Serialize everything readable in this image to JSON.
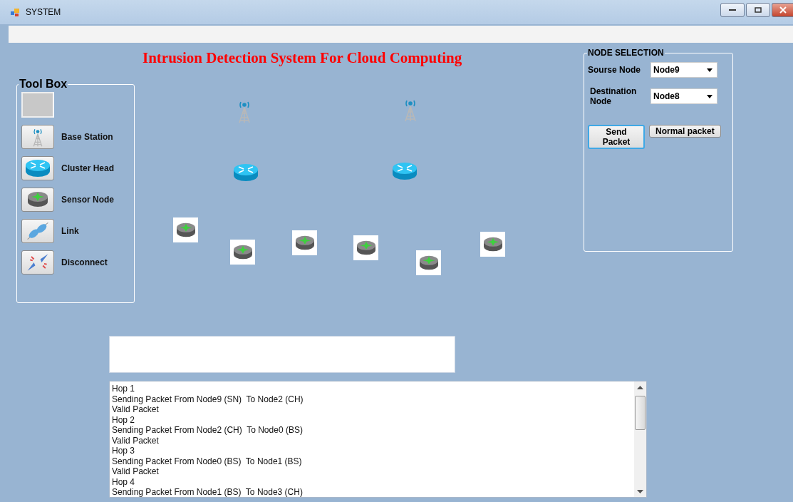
{
  "window": {
    "title": "SYSTEM"
  },
  "header": {
    "title": "Intrusion Detection System For Cloud Computing"
  },
  "tool_box": {
    "title": "Tool Box",
    "items": [
      {
        "kind": "blank"
      },
      {
        "kind": "base_station",
        "label": "Base Station"
      },
      {
        "kind": "cluster_head",
        "label": "Cluster Head"
      },
      {
        "kind": "sensor_node",
        "label": "Sensor Node"
      },
      {
        "kind": "link",
        "label": "Link"
      },
      {
        "kind": "disconnect",
        "label": "Disconnect"
      }
    ]
  },
  "network_nodes": [
    {
      "kind": "base_station"
    },
    {
      "kind": "base_station"
    },
    {
      "kind": "cluster_head"
    },
    {
      "kind": "cluster_head"
    },
    {
      "kind": "sensor_node"
    },
    {
      "kind": "sensor_node"
    },
    {
      "kind": "sensor_node"
    },
    {
      "kind": "sensor_node"
    },
    {
      "kind": "sensor_node"
    },
    {
      "kind": "sensor_node"
    }
  ],
  "node_selection": {
    "title": "NODE SELECTION",
    "source_label": "Sourse Node",
    "source_value": "Node9",
    "destination_label": "Destination Node",
    "destination_value": "Node8",
    "buttons": [
      {
        "label": "Send Packet",
        "focused": true
      },
      {
        "label": "Normal packet",
        "focused": false
      }
    ]
  },
  "log": {
    "lines": [
      "Hop 1",
      "Sending Packet From Node9 (SN)  To Node2 (CH)",
      "Valid Packet",
      "Hop 2",
      "Sending Packet From Node2 (CH)  To Node0 (BS)",
      "Valid Packet",
      "Hop 3",
      "Sending Packet From Node0 (BS)  To Node1 (BS)",
      "Valid Packet",
      "Hop 4",
      "Sending Packet From Node1 (BS)  To Node3 (CH)"
    ]
  }
}
